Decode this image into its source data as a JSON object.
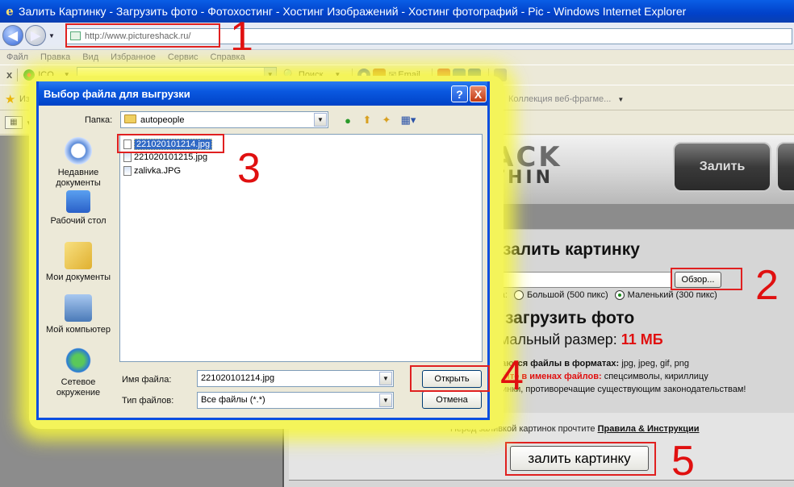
{
  "window": {
    "title": "Залить Картинку - Загрузить фото - Фотохостинг - Хостинг Изображений - Хостинг фотографий - Pic - Windows Internet Explorer"
  },
  "address": {
    "url": "http://www.pictureshack.ru/"
  },
  "menu": [
    "Файл",
    "Правка",
    "Вид",
    "Избранное",
    "Сервис",
    "Справка"
  ],
  "toolbar": {
    "x_label": "x",
    "icq_label": "ICQ",
    "search_label": "Поиск",
    "email_label": "Email"
  },
  "favorites": {
    "label": "Изб",
    "webslice": "Коллекция веб-фрагме..."
  },
  "site": {
    "logo_top": "ACK",
    "logo_bottom": "THIN",
    "nav_upload": "Залить",
    "heading_upload": "залить картинку",
    "browse": "Обзор...",
    "size_label": "мера:",
    "size_large": "Большой (500 пикс)",
    "size_small": "Маленький (300 пикс)",
    "heading_photo": "загрузить фото",
    "max_size_label": "симальный размер:",
    "max_size_value": "11 МБ",
    "formats_label": "живаются файлы в форматах:",
    "formats_value": "jpg, jpeg, gif, png",
    "forbidden_label": "льзуйте в именах файлов:",
    "forbidden_value": "спецсимволы, кириллицу",
    "law_text": "картинки, противоречащие существующим законодательствам!",
    "read_first": "Перед заливкой картинок прочтите",
    "rules_link": "Правила & Инструкции",
    "upload_button": "залить картинку"
  },
  "dialog": {
    "title": "Выбор файла для выгрузки",
    "help": "?",
    "close": "X",
    "folder_label": "Папка:",
    "folder_value": "autopeople",
    "places": [
      "Недавние документы",
      "Рабочий стол",
      "Мои документы",
      "Мой компьютер",
      "Сетевое окружение"
    ],
    "files": [
      "221020101214.jpg",
      "221020101215.jpg",
      "zalivka.JPG"
    ],
    "filename_label": "Имя файла:",
    "filename_value": "221020101214.jpg",
    "filetype_label": "Тип файлов:",
    "filetype_value": "Все файлы (*.*)",
    "open_button": "Открыть",
    "cancel_button": "Отмена"
  },
  "annotations": [
    "1",
    "2",
    "3",
    "4",
    "5"
  ],
  "colors": {
    "annotation_red": "#e01010",
    "xp_blue": "#0a58e0",
    "highlight_yellow": "#f4f45a"
  }
}
